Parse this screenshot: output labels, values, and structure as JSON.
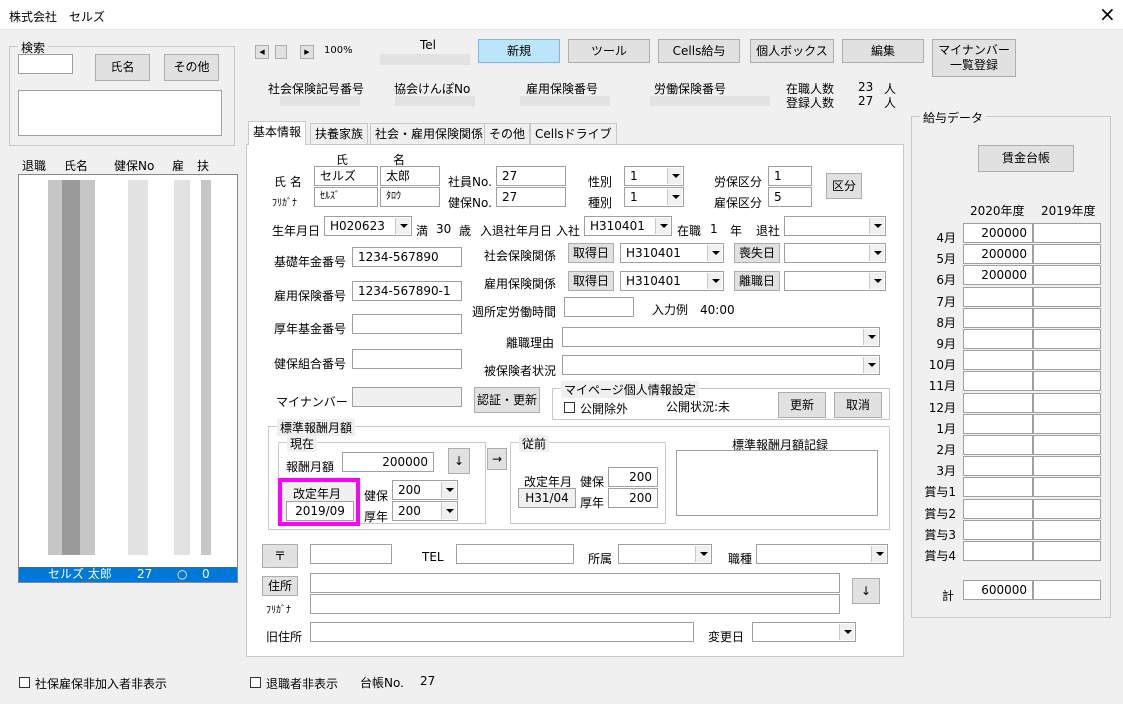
{
  "window": {
    "title": "株式会社　セルズ",
    "close_glyph": "×"
  },
  "search": {
    "label": "検索",
    "name_button": "氏名",
    "other_button": "その他"
  },
  "list": {
    "headers": [
      "退職",
      "氏名",
      "健保No",
      "雇",
      "扶"
    ],
    "selected_row": {
      "name": "セルズ 太郎",
      "kenpo": "27",
      "koyo": "○",
      "fuyo": "0"
    }
  },
  "zoom": {
    "value": "100%"
  },
  "tel_label": "Tel",
  "toolbar": {
    "new": "新規",
    "tool": "ツール",
    "cells_salary": "Cells給与",
    "personal_box": "個人ボックス",
    "edit": "編集",
    "mynumber_1": "マイナンバー",
    "mynumber_2": "一覧登録"
  },
  "header_info": {
    "shaho": "社会保険記号番号",
    "kyokai": "協会けんぽNo",
    "koyo": "雇用保険番号",
    "rodo": "労働保険番号",
    "zaishoku_label": "在職人数",
    "zaishoku_count": "23",
    "zaishoku_unit": "人",
    "toroku_label": "登録人数",
    "toroku_count": "27",
    "toroku_unit": "人"
  },
  "tabs": [
    "基本情報",
    "扶養家族",
    "社会・雇用保険関係",
    "その他",
    "Cellsドライブ"
  ],
  "basic": {
    "shi_label": "氏",
    "mei_label": "名",
    "name_label": "氏 名",
    "furigana_label": "ﾌﾘｶﾞﾅ",
    "sei": "セルズ",
    "mei": "太郎",
    "sei_kana": "ｾﾙｽﾞ",
    "mei_kana": "ﾀﾛｳ",
    "shain_no_label": "社員No.",
    "shain_no": "27",
    "kenpo_no_label": "健保No.",
    "kenpo_no": "27",
    "gender_label": "性別",
    "gender": "1",
    "kind_label": "種別",
    "kind": "1",
    "rouho_label": "労保区分",
    "rouho": "1",
    "koho_label": "雇保区分",
    "koho": "5",
    "kubun_button": "区分",
    "birth_label": "生年月日",
    "birth": "H020623",
    "age_prefix": "満",
    "age": "30",
    "age_unit": "歳",
    "nyutai_label": "入退社年月日",
    "nyusha_label": "入社",
    "nyusha": "H310401",
    "zaishoku_label": "在職",
    "zaishoku_years": "1",
    "years_unit": "年",
    "taisha_label": "退社",
    "taisha": "",
    "kiso_label": "基礎年金番号",
    "kiso": "1234-567890",
    "koyo_no_label": "雇用保険番号",
    "koyo_no": "1234-567890-1",
    "kosei_kikin_label": "厚年基金番号",
    "kosei_kikin": "",
    "kenko_kumiai_label": "健保組合番号",
    "kenko_kumiai": "",
    "mynumber_label": "マイナンバー",
    "ninsho_button": "認証・更新",
    "shaho_kankei_label": "社会保険関係",
    "shutoku_button": "取得日",
    "shaho_shutoku": "H310401",
    "soshitsu_button": "喪失日",
    "shaho_soshitsu": "",
    "koyo_kankei_label": "雇用保険関係",
    "koyo_shutoku": "H310401",
    "rishoku_button": "離職日",
    "koyo_rishoku": "",
    "shukan_label": "週所定労働時間",
    "shukan": "",
    "input_example": "入力例　40:00",
    "rishoku_riyu_label": "離職理由",
    "rishoku_riyu": "",
    "hihoken_label": "被保険者状況",
    "hihoken": ""
  },
  "mypage": {
    "title": "マイページ個人情報設定",
    "exclude_label": "公開除外",
    "status": "公開状況:未",
    "update_button": "更新",
    "cancel_button": "取消"
  },
  "hyojun": {
    "title": "標準報酬月額",
    "current_title": "現在",
    "hoshu_label": "報酬月額",
    "hoshu_value": "200000",
    "down_arrow": "↓",
    "right_arrow": "→",
    "kaitei_label": "改定年月",
    "kaitei_value": "2019/09",
    "kenpo_label": "健保",
    "kenpo_value": "200",
    "kounen_label": "厚年",
    "kounen_value": "200",
    "prev_title": "従前",
    "prev_kaitei_label": "改定年月",
    "prev_kaitei": "H31/04",
    "prev_kenpo_label": "健保",
    "prev_kenpo": "200",
    "prev_kounen_label": "厚年",
    "prev_kounen": "200",
    "record_title": "標準報酬月額記録"
  },
  "address": {
    "zip_button": "〒",
    "zip": "",
    "tel_label": "TEL",
    "tel": "",
    "shozoku_label": "所属",
    "shozoku": "",
    "shokushu_label": "職種",
    "shokushu": "",
    "address_button": "住所",
    "address": "",
    "furigana_label": "ﾌﾘｶﾞﾅ",
    "address_kana": "",
    "down_arrow": "↓",
    "old_address_label": "旧住所",
    "old_address": "",
    "change_date_label": "変更日",
    "change_date": ""
  },
  "salary": {
    "title": "給与データ",
    "ledger_button": "賃金台帳",
    "year_2020": "2020年度",
    "year_2019": "2019年度",
    "rows": [
      {
        "month": "4月",
        "v2020": "200000",
        "v2019": ""
      },
      {
        "month": "5月",
        "v2020": "200000",
        "v2019": ""
      },
      {
        "month": "6月",
        "v2020": "200000",
        "v2019": ""
      },
      {
        "month": "7月",
        "v2020": "",
        "v2019": ""
      },
      {
        "month": "8月",
        "v2020": "",
        "v2019": ""
      },
      {
        "month": "9月",
        "v2020": "",
        "v2019": ""
      },
      {
        "month": "10月",
        "v2020": "",
        "v2019": ""
      },
      {
        "month": "11月",
        "v2020": "",
        "v2019": ""
      },
      {
        "month": "12月",
        "v2020": "",
        "v2019": ""
      },
      {
        "month": "1月",
        "v2020": "",
        "v2019": ""
      },
      {
        "month": "2月",
        "v2020": "",
        "v2019": ""
      },
      {
        "month": "3月",
        "v2020": "",
        "v2019": ""
      },
      {
        "month": "賞与1",
        "v2020": "",
        "v2019": ""
      },
      {
        "month": "賞与2",
        "v2020": "",
        "v2019": ""
      },
      {
        "month": "賞与3",
        "v2020": "",
        "v2019": ""
      },
      {
        "month": "賞与4",
        "v2020": "",
        "v2019": ""
      }
    ],
    "total_label": "計",
    "total_2020": "600000",
    "total_2019": ""
  },
  "footer": {
    "hide_shaho_label": "社保雇保非加入者非表示",
    "hide_retired_label": "退職者非表示",
    "daicho_label": "台帳No.",
    "daicho_no": "27"
  },
  "colors": {
    "highlight": "#ff00ff",
    "selection": "#0078d7",
    "new_button": "#bce4fa"
  }
}
